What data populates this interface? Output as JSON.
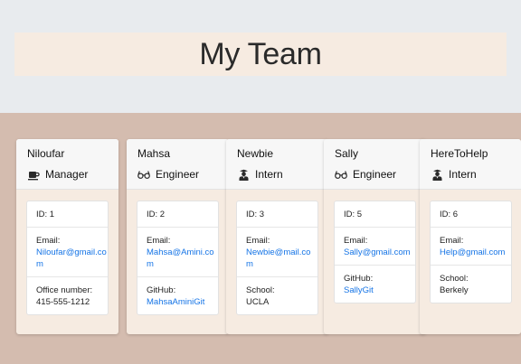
{
  "header": {
    "title": "My Team"
  },
  "cards": [
    {
      "name": "Niloufar",
      "role": "Manager",
      "role_icon": "coffee-cup-icon",
      "id_label": "ID: 1",
      "email_label": "Email:",
      "email": "Niloufar@gmail.com",
      "extra_label": "Office number:",
      "extra_value": "415-555-1212"
    },
    {
      "name": "Mahsa",
      "role": "Engineer",
      "role_icon": "glasses-icon",
      "id_label": "ID: 2",
      "email_label": "Email:",
      "email": "Mahsa@Amini.com",
      "extra_label": "GitHub:",
      "extra_value": "MahsaAminiGit"
    },
    {
      "name": "Newbie",
      "role": "Intern",
      "role_icon": "student-icon",
      "id_label": "ID: 3",
      "email_label": "Email:",
      "email": "Newbie@mail.com",
      "extra_label": "School:",
      "extra_value": "UCLA"
    },
    {
      "name": "Sally",
      "role": "Engineer",
      "role_icon": "glasses-icon",
      "id_label": "ID: 5",
      "email_label": "Email:",
      "email": "Sally@gmail.com",
      "extra_label": "GitHub:",
      "extra_value": "SallyGit"
    },
    {
      "name": "HereToHelp",
      "role": "Intern",
      "role_icon": "student-icon",
      "id_label": "ID: 6",
      "email_label": "Email:",
      "email": "Help@gmail.com",
      "extra_label": "School:",
      "extra_value": "Berkely"
    }
  ],
  "colors": {
    "page_background": "#d4bcaf",
    "top_band": "#e8ebee",
    "header_box": "#f6ebe1",
    "card_body": "#f6ebe1",
    "link": "#1574e6"
  }
}
